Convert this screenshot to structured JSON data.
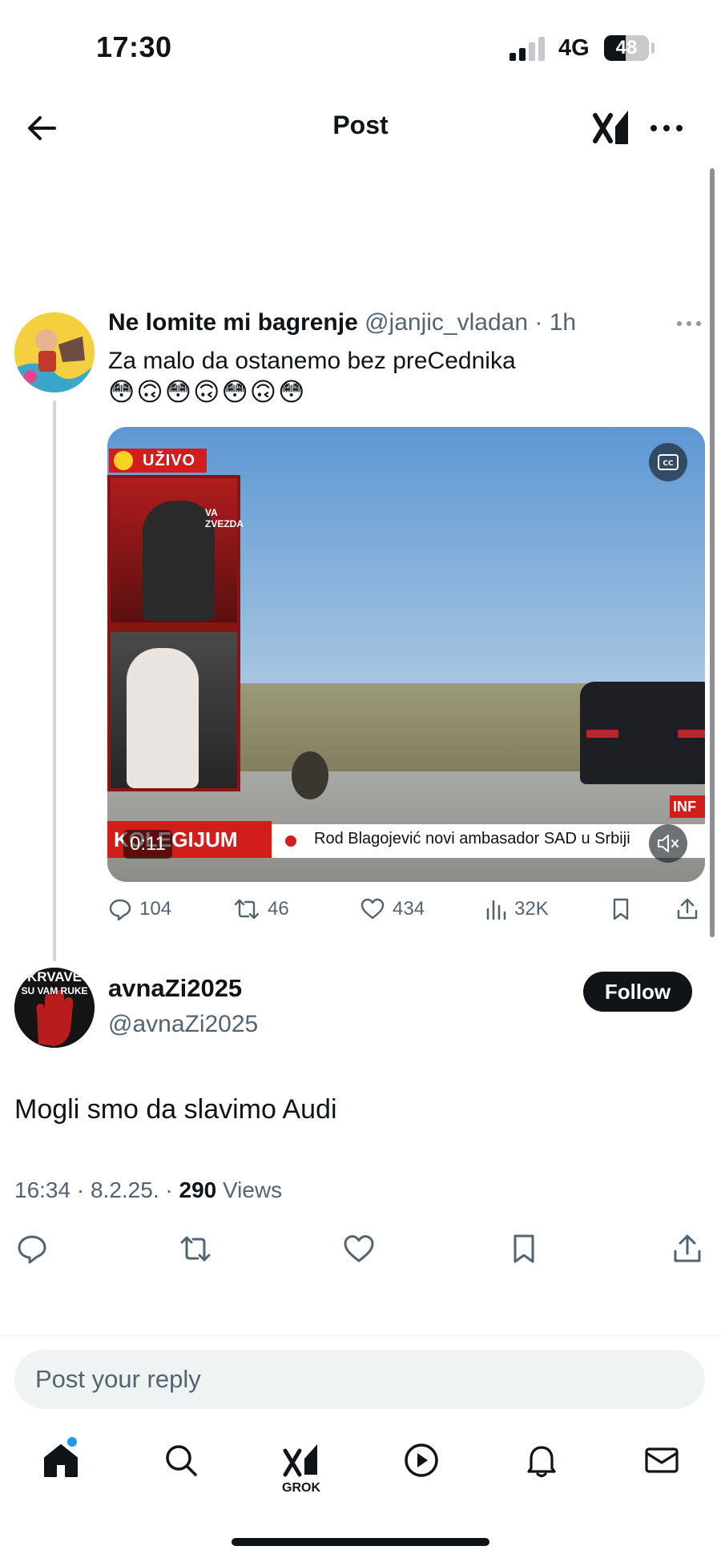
{
  "status_bar": {
    "time": "17:30",
    "network": "4G",
    "battery": "48",
    "signal_bars": 2
  },
  "header": {
    "title": "Post"
  },
  "parent_tweet": {
    "name": "Ne lomite mi bagrenje",
    "handle": "@janjic_vladan",
    "separator": "·",
    "time": "1h",
    "text": "Za malo da ostanemo bez preCednika",
    "emoji": "😳🙃😳🙃😳🙃😳",
    "video": {
      "live_label": "UŽIVO",
      "studio_label": "VA ZVEZDA",
      "ticker_brand": "KOLEGIJUM",
      "ticker_text": "Rod Blagojević novi ambasador SAD u Srbiji",
      "corner_label": "INF",
      "duration": "0:11"
    },
    "stats": {
      "replies": "104",
      "reposts": "46",
      "likes": "434",
      "views": "32K"
    }
  },
  "reply_tweet": {
    "name": "avnaZi2025",
    "handle": "@avnaZi2025",
    "avatar_text_1": "KRVAVE",
    "avatar_text_2": "SU VAM RUKE",
    "follow_label": "Follow",
    "text": "Mogli smo da slavimo Audi",
    "time": "16:34",
    "date": "8.2.25.",
    "separator": "·",
    "views_count": "290",
    "views_label": "Views"
  },
  "reply_box": {
    "placeholder": "Post your reply"
  },
  "bottom_nav": {
    "grok_label": "GROK"
  },
  "colors": {
    "text": "#0f1419",
    "secondary": "#536471",
    "accent": "#1d9bf0",
    "live_red": "#d31c1c"
  },
  "icons": [
    "back-arrow-icon",
    "grok-icon",
    "more-icon",
    "reply-icon",
    "repost-icon",
    "like-icon",
    "views-icon",
    "bookmark-icon",
    "share-icon",
    "home-icon",
    "search-icon",
    "play-icon",
    "bell-icon",
    "mail-icon",
    "cc-icon",
    "mute-icon"
  ]
}
